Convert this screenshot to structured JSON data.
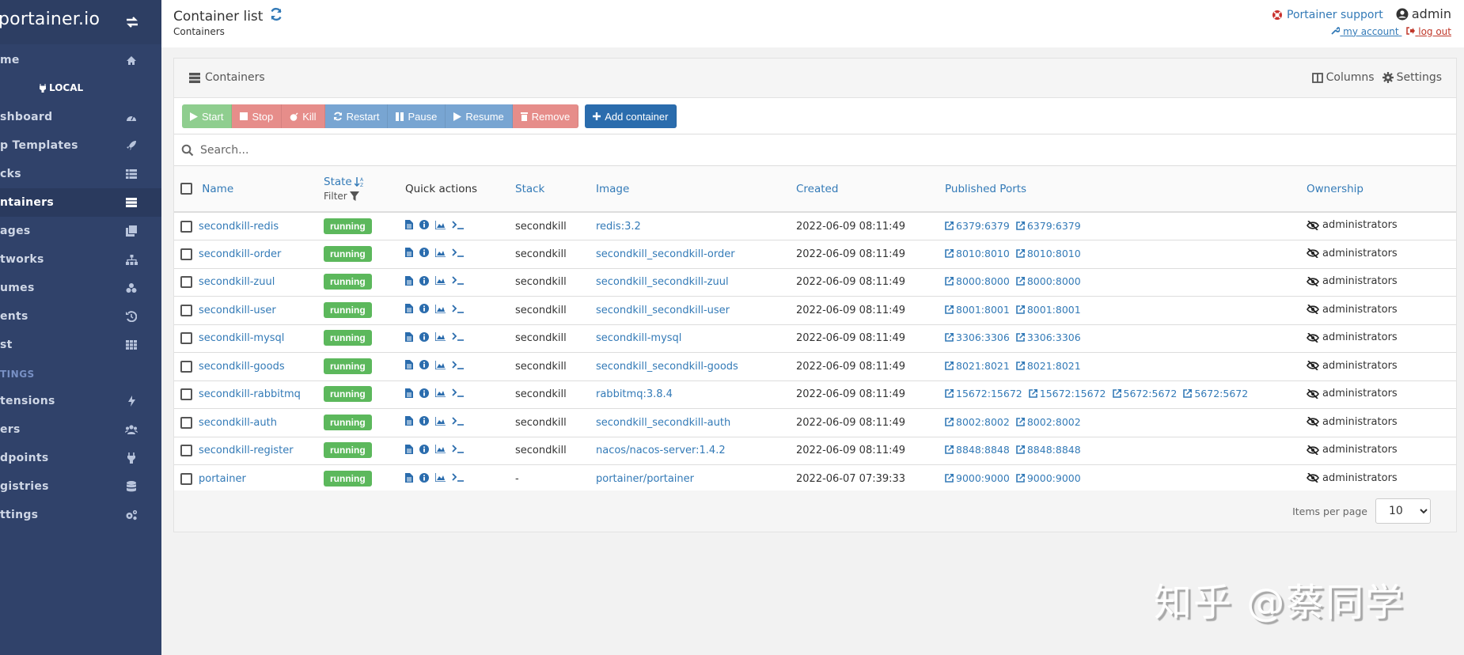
{
  "app": {
    "logo": "portainer.io"
  },
  "sidebar": {
    "home": "me",
    "environment": "LOCAL",
    "items": [
      {
        "label": "shboard",
        "icon": "tachometer-icon"
      },
      {
        "label": "p Templates",
        "icon": "rocket-icon"
      },
      {
        "label": "cks",
        "icon": "th-list-icon"
      },
      {
        "label": "ntainers",
        "icon": "server-icon",
        "active": true
      },
      {
        "label": "ages",
        "icon": "clone-icon"
      },
      {
        "label": "tworks",
        "icon": "sitemap-icon"
      },
      {
        "label": "umes",
        "icon": "cubes-icon"
      },
      {
        "label": "ents",
        "icon": "history-icon"
      },
      {
        "label": "st",
        "icon": "th-icon"
      }
    ],
    "settings_section": "TINGS",
    "settings_items": [
      {
        "label": "tensions",
        "icon": "bolt-icon"
      },
      {
        "label": "ers",
        "icon": "users-icon"
      },
      {
        "label": "dpoints",
        "icon": "plug-icon"
      },
      {
        "label": "gistries",
        "icon": "database-icon"
      },
      {
        "label": "ttings",
        "icon": "cogs-icon"
      }
    ]
  },
  "header": {
    "title": "Container list",
    "breadcrumb": "Containers",
    "support": "Portainer support",
    "user": "admin",
    "my_account": "my account",
    "log_out": "log out"
  },
  "widget": {
    "title": "Containers",
    "columns_label": "Columns",
    "settings_label": "Settings",
    "buttons": {
      "start": "Start",
      "stop": "Stop",
      "kill": "Kill",
      "restart": "Restart",
      "pause": "Pause",
      "resume": "Resume",
      "remove": "Remove",
      "add": "Add container"
    },
    "search_placeholder": "Search...",
    "columns": {
      "name": "Name",
      "state": "State",
      "filter": "Filter",
      "quick_actions": "Quick actions",
      "stack": "Stack",
      "image": "Image",
      "created": "Created",
      "ports": "Published Ports",
      "ownership": "Ownership"
    },
    "rows": [
      {
        "name": "secondkill-redis",
        "state": "running",
        "stack": "secondkill",
        "image": "redis:3.2",
        "created": "2022-06-09 08:11:49",
        "ports": [
          "6379:6379",
          "6379:6379"
        ],
        "ownership": "administrators"
      },
      {
        "name": "secondkill-order",
        "state": "running",
        "stack": "secondkill",
        "image": "secondkill_secondkill-order",
        "created": "2022-06-09 08:11:49",
        "ports": [
          "8010:8010",
          "8010:8010"
        ],
        "ownership": "administrators"
      },
      {
        "name": "secondkill-zuul",
        "state": "running",
        "stack": "secondkill",
        "image": "secondkill_secondkill-zuul",
        "created": "2022-06-09 08:11:49",
        "ports": [
          "8000:8000",
          "8000:8000"
        ],
        "ownership": "administrators"
      },
      {
        "name": "secondkill-user",
        "state": "running",
        "stack": "secondkill",
        "image": "secondkill_secondkill-user",
        "created": "2022-06-09 08:11:49",
        "ports": [
          "8001:8001",
          "8001:8001"
        ],
        "ownership": "administrators"
      },
      {
        "name": "secondkill-mysql",
        "state": "running",
        "stack": "secondkill",
        "image": "secondkill-mysql",
        "created": "2022-06-09 08:11:49",
        "ports": [
          "3306:3306",
          "3306:3306"
        ],
        "ownership": "administrators"
      },
      {
        "name": "secondkill-goods",
        "state": "running",
        "stack": "secondkill",
        "image": "secondkill_secondkill-goods",
        "created": "2022-06-09 08:11:49",
        "ports": [
          "8021:8021",
          "8021:8021"
        ],
        "ownership": "administrators"
      },
      {
        "name": "secondkill-rabbitmq",
        "state": "running",
        "stack": "secondkill",
        "image": "rabbitmq:3.8.4",
        "created": "2022-06-09 08:11:49",
        "ports": [
          "15672:15672",
          "15672:15672",
          "5672:5672",
          "5672:5672"
        ],
        "ownership": "administrators"
      },
      {
        "name": "secondkill-auth",
        "state": "running",
        "stack": "secondkill",
        "image": "secondkill_secondkill-auth",
        "created": "2022-06-09 08:11:49",
        "ports": [
          "8002:8002",
          "8002:8002"
        ],
        "ownership": "administrators"
      },
      {
        "name": "secondkill-register",
        "state": "running",
        "stack": "secondkill",
        "image": "nacos/nacos-server:1.4.2",
        "created": "2022-06-09 08:11:49",
        "ports": [
          "8848:8848",
          "8848:8848"
        ],
        "ownership": "administrators"
      },
      {
        "name": "portainer",
        "state": "running",
        "stack": "-",
        "image": "portainer/portainer",
        "created": "2022-06-07 07:39:33",
        "ports": [
          "9000:9000",
          "9000:9000"
        ],
        "ownership": "administrators"
      }
    ],
    "items_per_page_label": "Items per page",
    "items_per_page": "10"
  },
  "watermark": "知乎 @蔡同学",
  "colors": {
    "sidebar": "#30426a",
    "primary": "#337ab7",
    "running": "#5cb85c"
  }
}
